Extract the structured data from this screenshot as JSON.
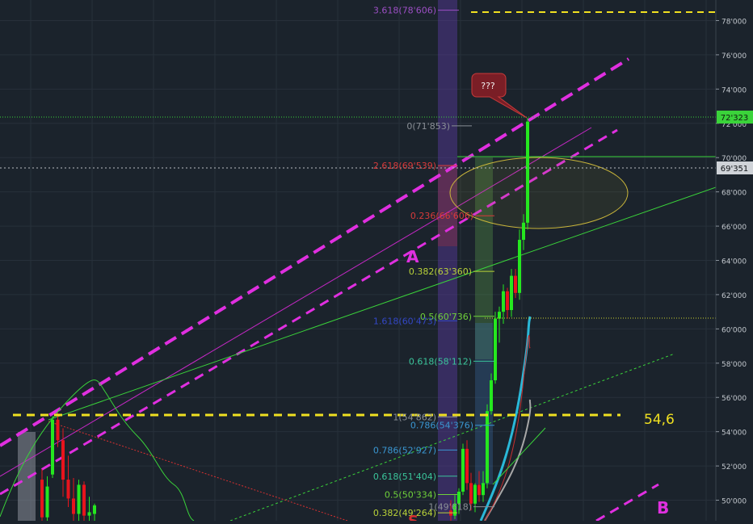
{
  "chart_data": {
    "type": "candlestick",
    "ylim": [
      48800,
      79200
    ],
    "price_axis": {
      "ticks": [
        50000,
        52000,
        54000,
        56000,
        58000,
        60000,
        62000,
        64000,
        66000,
        68000,
        70000,
        72000,
        74000,
        76000,
        78000
      ],
      "tick_labels": [
        "50'000",
        "52'000",
        "54'000",
        "56'000",
        "58'000",
        "60'000",
        "62'000",
        "64'000",
        "66'000",
        "68'000",
        "70'000",
        "72'000",
        "74'000",
        "76'000",
        "78'000"
      ],
      "last_price_label": "72'323",
      "last_price": 72323,
      "marker_label": "69'351",
      "marker_price": 69351
    },
    "fib_levels": [
      {
        "label": "3.618(78'606)",
        "price": 78606,
        "color": "#9c4fc4"
      },
      {
        "label": "0(71'853)",
        "price": 71853,
        "color": "#8a8f96"
      },
      {
        "label": "2.618(69'539)",
        "price": 69539,
        "color": "#d83a3a"
      },
      {
        "label": "0.236(66'606)",
        "price": 66606,
        "color": "#d83a3a"
      },
      {
        "label": "0.382(63'360)",
        "price": 63360,
        "color": "#b9d239"
      },
      {
        "label": "0.5(60'736)",
        "price": 60736,
        "color": "#6fd13a"
      },
      {
        "label": "1.618(60'473)",
        "price": 60473,
        "color": "#3347c4"
      },
      {
        "label": "0.618(58'112)",
        "price": 58112,
        "color": "#3ac49a"
      },
      {
        "label": "1(54'862)",
        "price": 54862,
        "color": "#8a8f96"
      },
      {
        "label": "0.786(54'376)",
        "price": 54376,
        "color": "#3a96d1"
      },
      {
        "label": "0.786(52'927)",
        "price": 52927,
        "color": "#3a96d1"
      },
      {
        "label": "0.618(51'404)",
        "price": 51404,
        "color": "#3ac49a"
      },
      {
        "label": "0.5(50'334)",
        "price": 50334,
        "color": "#6fd13a"
      },
      {
        "label": "1(49'618)",
        "price": 49618,
        "color": "#8a8f96"
      },
      {
        "label": "0.382(49'264)",
        "price": 49264,
        "color": "#b9d239"
      }
    ],
    "annotations": {
      "wave_a": "A",
      "wave_b": "B",
      "level_text": "54,6",
      "callout": "???",
      "partial_label": "S"
    },
    "candles": [
      {
        "o": 51200,
        "h": 51800,
        "l": 48800,
        "c": 49000
      },
      {
        "o": 49000,
        "h": 51400,
        "l": 48800,
        "c": 50800
      },
      {
        "o": 51500,
        "h": 54900,
        "l": 51300,
        "c": 54700
      },
      {
        "o": 54700,
        "h": 55100,
        "l": 53100,
        "c": 53500
      },
      {
        "o": 53500,
        "h": 54200,
        "l": 50200,
        "c": 51200
      },
      {
        "o": 51200,
        "h": 52600,
        "l": 49600,
        "c": 50100
      },
      {
        "o": 50100,
        "h": 51300,
        "l": 48800,
        "c": 49200
      },
      {
        "o": 49200,
        "h": 51200,
        "l": 48800,
        "c": 50900
      },
      {
        "o": 50900,
        "h": 51100,
        "l": 48800,
        "c": 49100
      },
      {
        "o": 49100,
        "h": 50200,
        "l": 48800,
        "c": 49300
      },
      {
        "o": 49200,
        "h": 49800,
        "l": 48800,
        "c": 49700
      },
      {
        "o": 49400,
        "h": 50000,
        "l": 48800,
        "c": 49100
      },
      {
        "o": 49100,
        "h": 50300,
        "l": 48900,
        "c": 49800
      },
      {
        "o": 49800,
        "h": 50700,
        "l": 49200,
        "c": 50500
      },
      {
        "o": 50500,
        "h": 53300,
        "l": 50300,
        "c": 53000
      },
      {
        "o": 53000,
        "h": 53500,
        "l": 50600,
        "c": 51000
      },
      {
        "o": 51000,
        "h": 51600,
        "l": 49400,
        "c": 49800
      },
      {
        "o": 49800,
        "h": 51000,
        "l": 49300,
        "c": 50900
      },
      {
        "o": 50900,
        "h": 51700,
        "l": 49900,
        "c": 50300
      },
      {
        "o": 50300,
        "h": 51700,
        "l": 49900,
        "c": 51000
      },
      {
        "o": 51000,
        "h": 55600,
        "l": 50700,
        "c": 55200
      },
      {
        "o": 55200,
        "h": 57400,
        "l": 55000,
        "c": 57000
      },
      {
        "o": 57000,
        "h": 61000,
        "l": 56800,
        "c": 60600
      },
      {
        "o": 60600,
        "h": 61300,
        "l": 59200,
        "c": 61000
      },
      {
        "o": 61000,
        "h": 62600,
        "l": 60300,
        "c": 62200
      },
      {
        "o": 62200,
        "h": 62400,
        "l": 60600,
        "c": 61100
      },
      {
        "o": 61100,
        "h": 63500,
        "l": 60700,
        "c": 63100
      },
      {
        "o": 63100,
        "h": 63500,
        "l": 61800,
        "c": 62100
      },
      {
        "o": 62100,
        "h": 65800,
        "l": 61700,
        "c": 65200
      },
      {
        "o": 65200,
        "h": 66700,
        "l": 64600,
        "c": 66200
      },
      {
        "o": 66200,
        "h": 72323,
        "l": 65800,
        "c": 72100
      }
    ]
  }
}
